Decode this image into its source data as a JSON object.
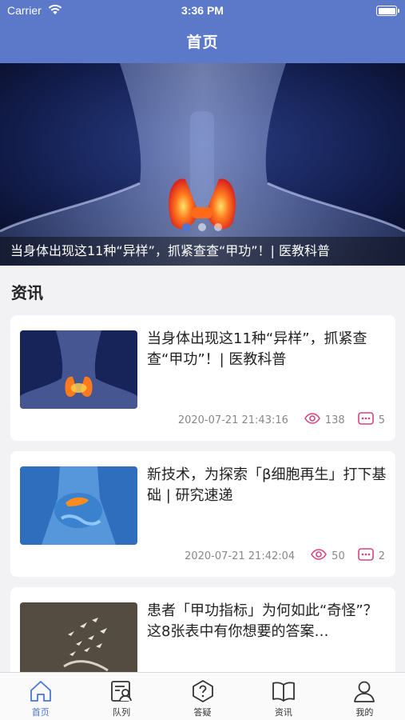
{
  "status_bar": {
    "carrier": "Carrier",
    "time": "3:36 PM"
  },
  "nav": {
    "title": "首页"
  },
  "banner": {
    "caption": "当身体出现这11种“异样”，抓紧查查“甲功”！| 医教科普",
    "slide_count": 3,
    "active_slide": 1
  },
  "section": {
    "title": "资讯"
  },
  "news": [
    {
      "title": "当身体出现这11种“异样”，抓紧查查“甲功”！| 医教科普",
      "date": "2020-07-21 21:43:16",
      "views": "138",
      "comments": "5",
      "thumb_icon": "thyroid-image"
    },
    {
      "title": "新技术，为探索「β细胞再生」打下基础 | 研究速递",
      "date": "2020-07-21 21:42:04",
      "views": "50",
      "comments": "2",
      "thumb_icon": "pancreas-image"
    },
    {
      "title": "患者「甲功指标」为何如此“奇怪”？这8张表中有你想要的答案…",
      "date": "",
      "views": "",
      "comments": "",
      "thumb_icon": "birds-image"
    }
  ],
  "tabs": [
    {
      "label": "首页",
      "icon": "home-icon",
      "active": true
    },
    {
      "label": "队列",
      "icon": "queue-icon",
      "active": false
    },
    {
      "label": "答疑",
      "icon": "question-icon",
      "active": false
    },
    {
      "label": "资讯",
      "icon": "book-icon",
      "active": false
    },
    {
      "label": "我的",
      "icon": "user-icon",
      "active": false
    }
  ],
  "colors": {
    "header": "#5b78c9",
    "accent": "#4a76d6",
    "meta_icon": "#d6457f"
  }
}
